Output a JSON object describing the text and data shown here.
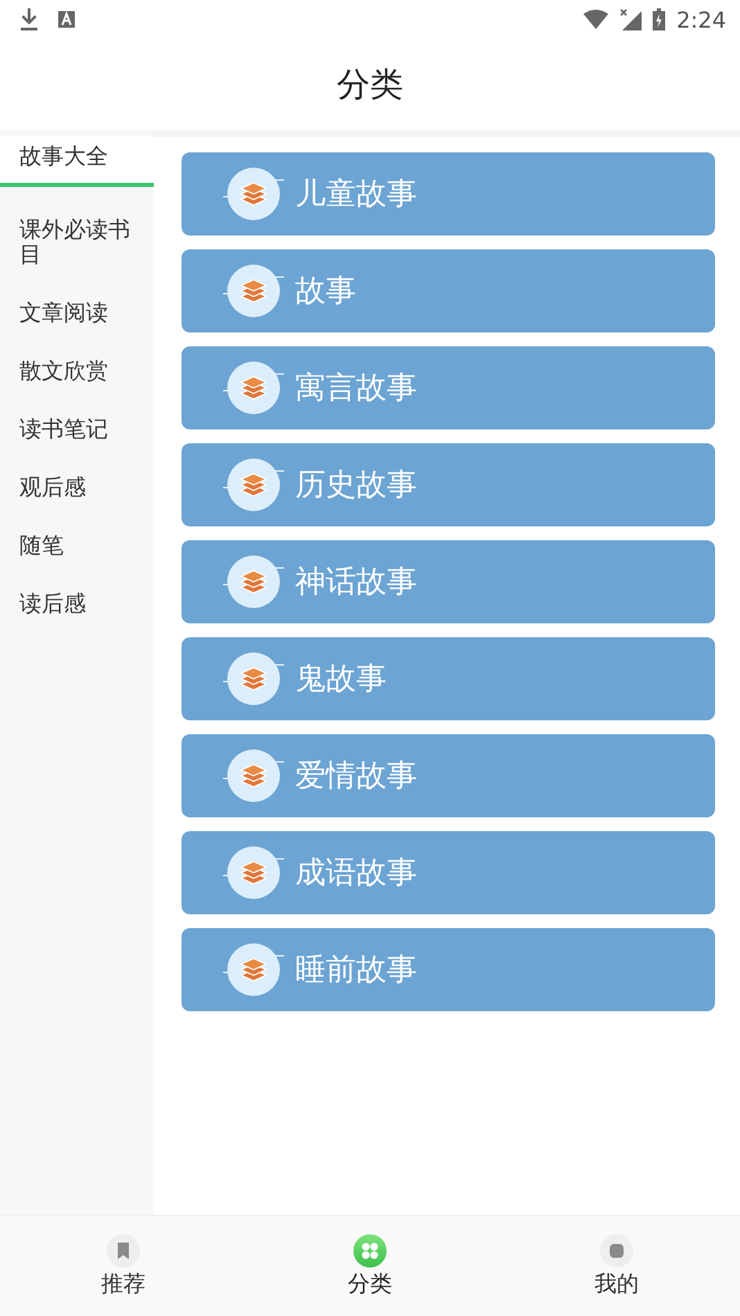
{
  "status_bar": {
    "time": "2:24"
  },
  "header": {
    "title": "分类"
  },
  "sidebar": {
    "items": [
      {
        "label": "故事大全",
        "selected": true
      },
      {
        "label": "课外必读书目",
        "selected": false
      },
      {
        "label": "文章阅读",
        "selected": false
      },
      {
        "label": "散文欣赏",
        "selected": false
      },
      {
        "label": "读书笔记",
        "selected": false
      },
      {
        "label": "观后感",
        "selected": false
      },
      {
        "label": "随笔",
        "selected": false
      },
      {
        "label": "读后感",
        "selected": false
      }
    ]
  },
  "categories": [
    {
      "label": "儿童故事"
    },
    {
      "label": "故事"
    },
    {
      "label": "寓言故事"
    },
    {
      "label": "历史故事"
    },
    {
      "label": "神话故事"
    },
    {
      "label": "鬼故事"
    },
    {
      "label": "爱情故事"
    },
    {
      "label": "成语故事"
    },
    {
      "label": "睡前故事"
    }
  ],
  "bottom_nav": [
    {
      "label": "推荐",
      "selected": false
    },
    {
      "label": "分类",
      "selected": true
    },
    {
      "label": "我的",
      "selected": false
    }
  ]
}
